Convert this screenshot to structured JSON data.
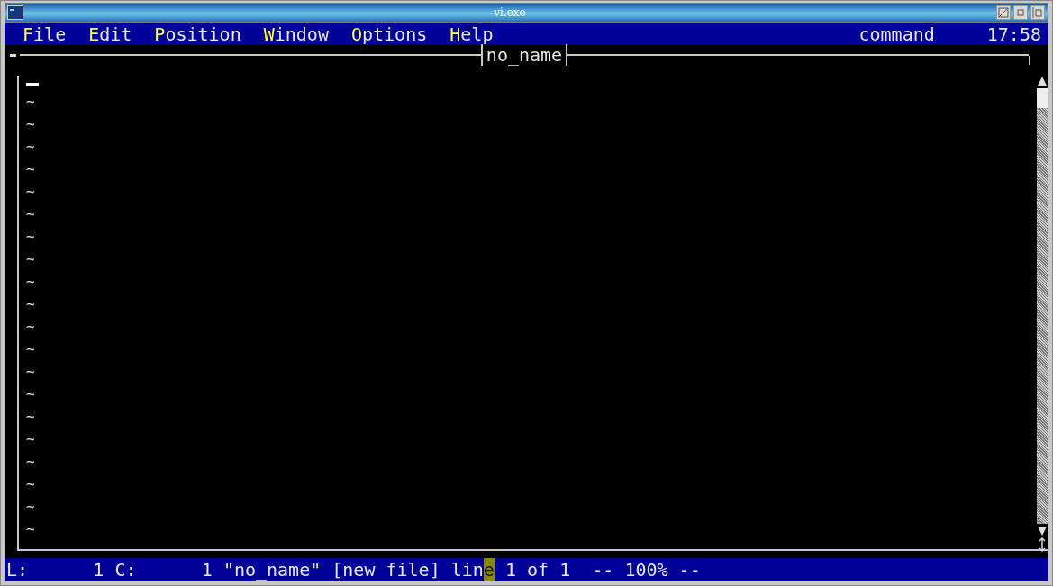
{
  "window": {
    "title": "vi.exe"
  },
  "menu": [
    {
      "hotkey": "F",
      "rest": "ile"
    },
    {
      "hotkey": "E",
      "rest": "dit"
    },
    {
      "hotkey": "P",
      "rest": "osition"
    },
    {
      "hotkey": "W",
      "rest": "indow"
    },
    {
      "hotkey": "O",
      "rest": "ptions"
    },
    {
      "hotkey": "H",
      "rest": "elp"
    }
  ],
  "mode": "command",
  "clock": "17:58",
  "editor": {
    "title": "no_name",
    "lines": [
      "~",
      "~",
      "~",
      "~",
      "~",
      "~",
      "~",
      "~",
      "~",
      "~",
      "~",
      "~",
      "~",
      "~",
      "~",
      "~",
      "~",
      "~",
      "~",
      "~"
    ]
  },
  "status_bar": {
    "line_label": "L:",
    "line": "1",
    "col_label": "C:",
    "col": "1",
    "message_before": "\"no_name\" [new file] lin",
    "cursor_char": "e",
    "message_after": "1 of 1  -- 100% --"
  }
}
